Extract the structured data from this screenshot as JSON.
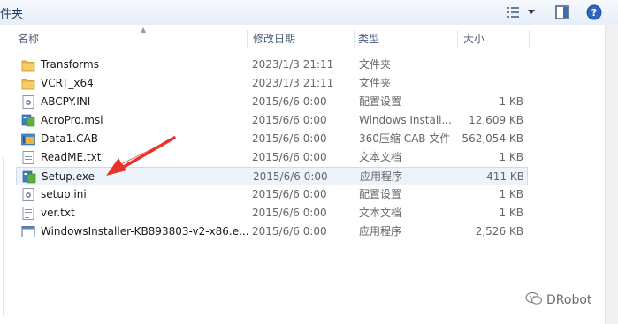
{
  "toolbar": {
    "label": "件夹",
    "view_icon": "view-list-icon",
    "dropdown_icon": "chevron-down-icon",
    "preview_icon": "preview-pane-icon",
    "help_icon": "help-icon"
  },
  "columns": {
    "name": "名称",
    "date": "修改日期",
    "type": "类型",
    "size": "大小"
  },
  "files": [
    {
      "icon": "folder-icon",
      "name": "Transforms",
      "date": "2023/1/3 21:11",
      "type": "文件夹",
      "size": ""
    },
    {
      "icon": "folder-icon",
      "name": "VCRT_x64",
      "date": "2023/1/3 21:11",
      "type": "文件夹",
      "size": ""
    },
    {
      "icon": "settings-file-icon",
      "name": "ABCPY.INI",
      "date": "2015/6/6 0:00",
      "type": "配置设置",
      "size": "1 KB"
    },
    {
      "icon": "installer-icon",
      "name": "AcroPro.msi",
      "date": "2015/6/6 0:00",
      "type": "Windows Install...",
      "size": "12,609 KB"
    },
    {
      "icon": "cab-file-icon",
      "name": "Data1.CAB",
      "date": "2015/6/6 0:00",
      "type": "360压缩 CAB 文件",
      "size": "562,054 KB"
    },
    {
      "icon": "text-file-icon",
      "name": "ReadME.txt",
      "date": "2015/6/6 0:00",
      "type": "文本文档",
      "size": "1 KB"
    },
    {
      "icon": "installer-icon",
      "name": "Setup.exe",
      "date": "2015/6/6 0:00",
      "type": "应用程序",
      "size": "411 KB"
    },
    {
      "icon": "settings-file-icon",
      "name": "setup.ini",
      "date": "2015/6/6 0:00",
      "type": "配置设置",
      "size": "1 KB"
    },
    {
      "icon": "text-file-icon",
      "name": "ver.txt",
      "date": "2015/6/6 0:00",
      "type": "文本文档",
      "size": "1 KB"
    },
    {
      "icon": "app-window-icon",
      "name": "WindowsInstaller-KB893803-v2-x86.e...",
      "date": "2015/6/6 0:00",
      "type": "应用程序",
      "size": "2,526 KB"
    }
  ],
  "highlighted_row": "Setup.exe",
  "annotation": {
    "color": "#e8322b",
    "icon": "red-arrow-icon"
  },
  "watermark": {
    "text": "DRobot",
    "icon": "wechat-icon"
  }
}
